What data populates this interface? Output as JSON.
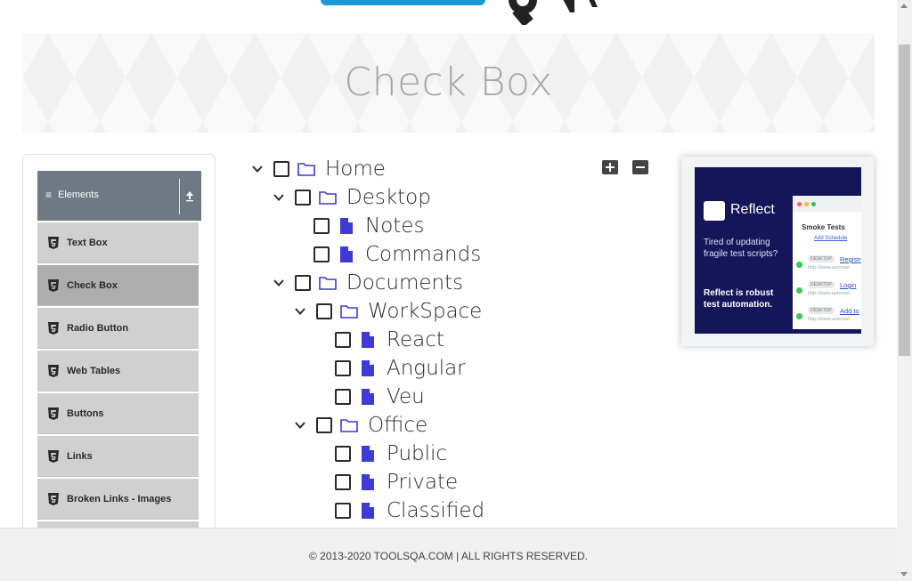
{
  "page": {
    "title": "Check Box"
  },
  "sidebar": {
    "group_title": "Elements",
    "items": [
      {
        "label": "Text Box",
        "active": false
      },
      {
        "label": "Check Box",
        "active": true
      },
      {
        "label": "Radio Button",
        "active": false
      },
      {
        "label": "Web Tables",
        "active": false
      },
      {
        "label": "Buttons",
        "active": false
      },
      {
        "label": "Links",
        "active": false
      },
      {
        "label": "Broken Links - Images",
        "active": false
      }
    ]
  },
  "tree": {
    "nodes": [
      {
        "label": "Home",
        "type": "folder",
        "expanded": true,
        "checked": false
      },
      {
        "label": "Desktop",
        "type": "folder",
        "expanded": true,
        "checked": false
      },
      {
        "label": "Notes",
        "type": "file",
        "checked": false
      },
      {
        "label": "Commands",
        "type": "file",
        "checked": false
      },
      {
        "label": "Documents",
        "type": "folder",
        "expanded": true,
        "checked": false
      },
      {
        "label": "WorkSpace",
        "type": "folder",
        "expanded": true,
        "checked": false
      },
      {
        "label": "React",
        "type": "file",
        "checked": false
      },
      {
        "label": "Angular",
        "type": "file",
        "checked": false
      },
      {
        "label": "Veu",
        "type": "file",
        "checked": false
      },
      {
        "label": "Office",
        "type": "folder",
        "expanded": true,
        "checked": false
      },
      {
        "label": "Public",
        "type": "file",
        "checked": false
      },
      {
        "label": "Private",
        "type": "file",
        "checked": false
      },
      {
        "label": "Classified",
        "type": "file",
        "checked": false
      }
    ]
  },
  "ad": {
    "brand": "Reflect",
    "text1": "Tired of updating fragile test scripts?",
    "text2": "Reflect is robust test automation.",
    "mock_title": "Smoke Tests",
    "mock_schedule": "Add Schedule",
    "rows": [
      {
        "tag": "DESKTOP",
        "link": "Registr",
        "url": "http://www.automat"
      },
      {
        "tag": "DESKTOP",
        "link": "Login",
        "url": "http://www.automat"
      },
      {
        "tag": "DESKTOP",
        "link": "Add to",
        "url": "http://www.automat"
      }
    ]
  },
  "footer": {
    "text": "© 2013-2020 TOOLSQA.COM | ALL RIGHTS RESERVED."
  },
  "colors": {
    "accent_icon": "#3d3ad6",
    "group_header": "#6f7883",
    "menu_bg": "#d0d0d0",
    "menu_active": "#adadad"
  }
}
